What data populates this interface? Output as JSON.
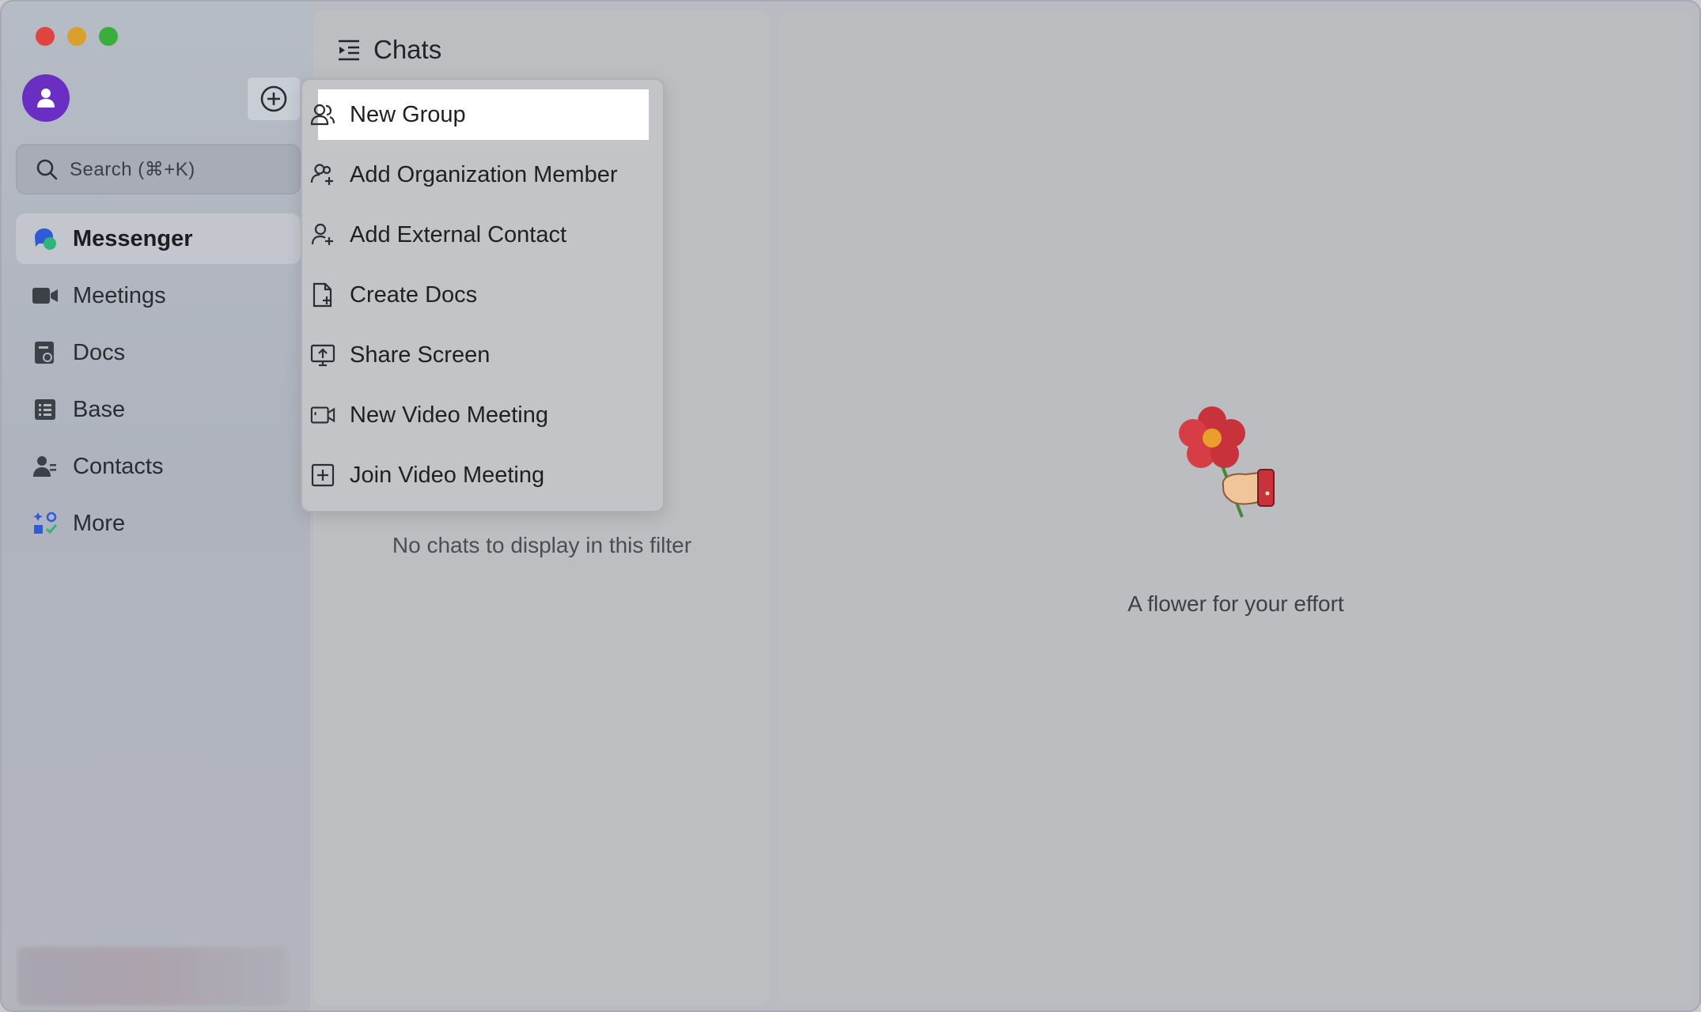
{
  "window": {
    "traffic_lights": [
      "close",
      "minimize",
      "zoom"
    ]
  },
  "sidebar": {
    "search_placeholder": "Search (⌘+K)",
    "items": [
      {
        "label": "Messenger",
        "icon": "messenger-icon",
        "active": true
      },
      {
        "label": "Meetings",
        "icon": "video-camera-icon",
        "active": false
      },
      {
        "label": "Docs",
        "icon": "docs-icon",
        "active": false
      },
      {
        "label": "Base",
        "icon": "base-table-icon",
        "active": false
      },
      {
        "label": "Contacts",
        "icon": "contacts-icon",
        "active": false
      },
      {
        "label": "More",
        "icon": "more-apps-icon",
        "active": false
      }
    ]
  },
  "chats": {
    "title": "Chats",
    "empty_message": "No chats to display in this filter"
  },
  "detail": {
    "message": "A flower for your effort"
  },
  "menu": {
    "items": [
      {
        "label": "New Group",
        "icon": "group-icon",
        "highlighted": true
      },
      {
        "label": "Add Organization Member",
        "icon": "add-member-icon"
      },
      {
        "label": "Add External Contact",
        "icon": "add-contact-icon"
      },
      {
        "label": "Create Docs",
        "icon": "create-doc-icon"
      },
      {
        "label": "Share Screen",
        "icon": "share-screen-icon"
      },
      {
        "label": "New Video Meeting",
        "icon": "video-meeting-icon"
      },
      {
        "label": "Join Video Meeting",
        "icon": "join-meeting-icon"
      }
    ]
  },
  "colors": {
    "avatar": "#6a2fc2",
    "messenger_blue": "#2f5bd8",
    "messenger_green": "#2fb57a",
    "traffic_red": "#e0443e",
    "traffic_yellow": "#d9a12c",
    "traffic_green": "#3aae3c"
  }
}
